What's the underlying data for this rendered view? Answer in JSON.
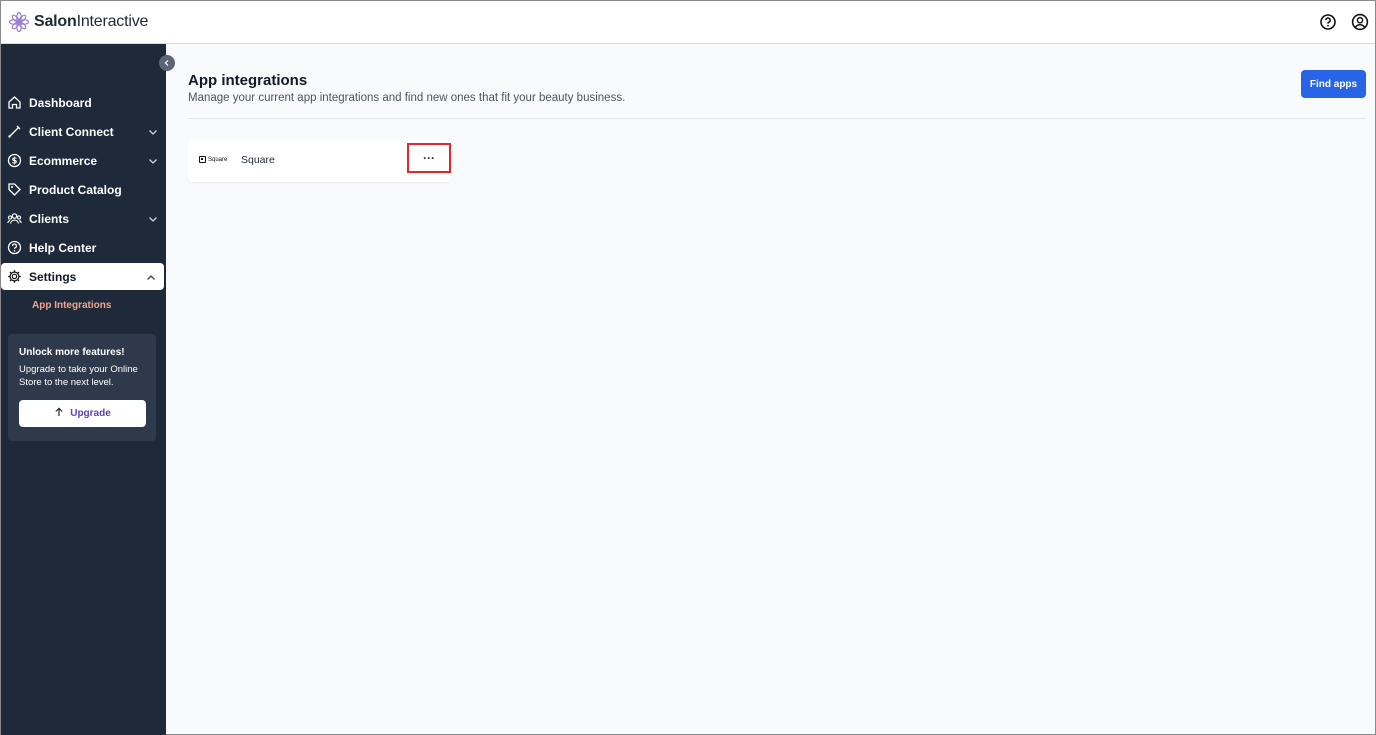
{
  "app": {
    "brand_bold": "Salon",
    "brand_light": "Interactive"
  },
  "topbar": {
    "help_icon": "help-circle-icon",
    "account_icon": "user-circle-icon"
  },
  "sidebar": {
    "items": [
      {
        "label": "Dashboard",
        "icon": "home-icon",
        "chevron": false
      },
      {
        "label": "Client Connect",
        "icon": "edit-pen-icon",
        "chevron": true
      },
      {
        "label": "Ecommerce",
        "icon": "dollar-circle-icon",
        "chevron": true
      },
      {
        "label": "Product Catalog",
        "icon": "tag-icon",
        "chevron": false
      },
      {
        "label": "Clients",
        "icon": "users-icon",
        "chevron": true
      },
      {
        "label": "Help Center",
        "icon": "help-circle-icon",
        "chevron": false
      },
      {
        "label": "Settings",
        "icon": "gear-icon",
        "chevron": true,
        "active": true
      }
    ],
    "sub_item": "App Integrations",
    "promo": {
      "title": "Unlock more features!",
      "text": "Upgrade to take your Online Store to the next level.",
      "button": "Upgrade"
    }
  },
  "main": {
    "title": "App integrations",
    "subtitle": "Manage your current app integrations and find new ones that fit your beauty business.",
    "find_button": "Find apps",
    "integrations": [
      {
        "logo_text": "Square",
        "name": "Square",
        "menu": "···"
      }
    ]
  },
  "colors": {
    "sidebar_bg": "#1e2a3a",
    "accent_blue": "#2864e6",
    "sub_item": "#f2a58c",
    "highlight": "#e0262e"
  }
}
